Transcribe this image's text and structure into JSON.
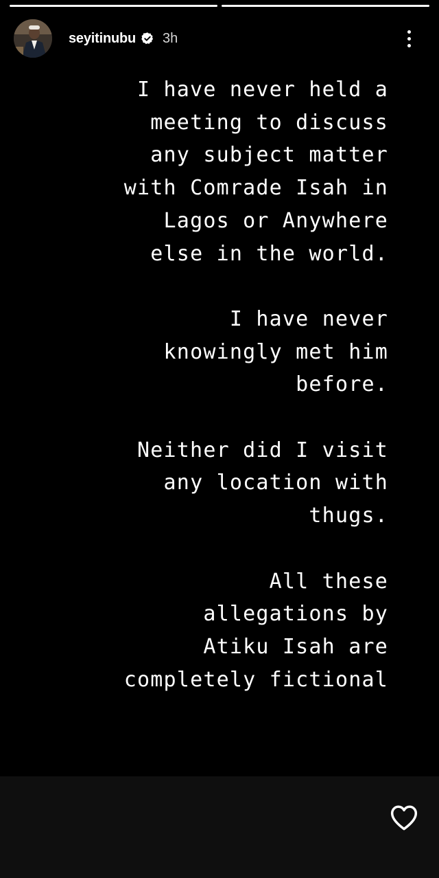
{
  "progress": {
    "segments": [
      {
        "state": "seen",
        "fill": 1.0
      },
      {
        "state": "current",
        "fill": 1.0
      }
    ]
  },
  "header": {
    "username": "seyitinubu",
    "verified_icon": "verified-badge-icon",
    "time": "3h",
    "menu_icon": "more-vertical-icon"
  },
  "story": {
    "paragraphs": [
      {
        "lines": [
          "I have never held a",
          "meeting to discuss",
          "any subject matter",
          "with Comrade Isah in",
          "Lagos or Anywhere",
          "else in the world."
        ]
      },
      {
        "lines": [
          "I have never",
          "knowingly met him",
          "before."
        ]
      },
      {
        "lines": [
          "Neither did I visit",
          "any location with",
          "thugs."
        ]
      },
      {
        "lines": [
          "All these",
          "allegations by",
          "Atiku Isah are",
          "completely fictional"
        ]
      }
    ]
  },
  "footer": {
    "like_icon": "heart-icon"
  },
  "colors": {
    "background": "#000000",
    "footer": "#0f0f0f",
    "text": "#ffffff",
    "muted": "#d6d6d6"
  }
}
